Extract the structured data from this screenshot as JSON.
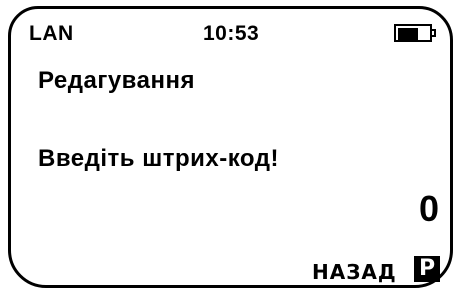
{
  "status_bar": {
    "network": "LAN",
    "time": "10:53",
    "battery_icon": "battery-icon",
    "battery_level": 0.6
  },
  "title": "Редагування",
  "prompt": "Введіть штрих-код!",
  "value": "0",
  "softkey": {
    "label": "НАЗАД",
    "key": "P"
  }
}
